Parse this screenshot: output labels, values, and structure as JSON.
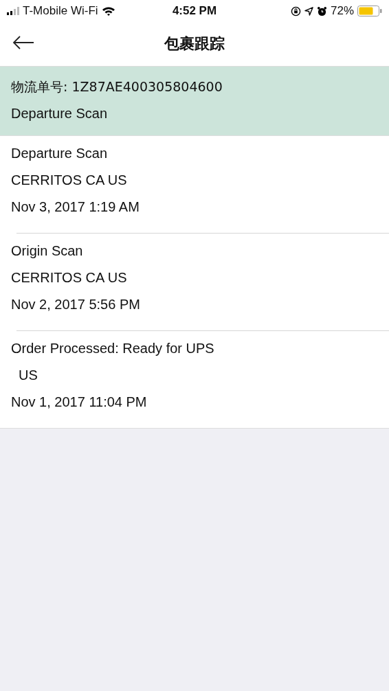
{
  "status_bar": {
    "carrier": "T-Mobile Wi-Fi",
    "time": "4:52 PM",
    "battery": "72%"
  },
  "nav": {
    "title": "包裹跟踪"
  },
  "summary": {
    "tracking": "物流单号: 1Z87AE400305804600",
    "status": "Departure Scan"
  },
  "events": [
    {
      "activity": "Departure Scan",
      "location": "CERRITOS CA US",
      "time": "Nov 3, 2017 1:19 AM"
    },
    {
      "activity": "Origin Scan",
      "location": "CERRITOS CA US",
      "time": "Nov 2, 2017 5:56 PM"
    },
    {
      "activity": "Order Processed: Ready for UPS",
      "location": "  US",
      "time": "Nov 1, 2017 11:04 PM"
    }
  ]
}
